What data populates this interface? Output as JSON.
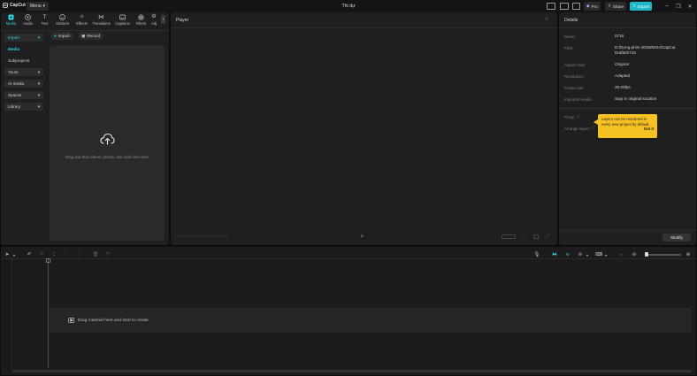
{
  "titlebar": {
    "app_name": "CapCut",
    "menu_label": "Menu",
    "project_title": "Thi dự",
    "pro_label": "Pro",
    "share_label": "Share",
    "export_label": "Export"
  },
  "tools": [
    {
      "label": "Media",
      "icon": "media-icon"
    },
    {
      "label": "Audio",
      "icon": "audio-icon"
    },
    {
      "label": "Text",
      "icon": "text-icon"
    },
    {
      "label": "Stickers",
      "icon": "stickers-icon"
    },
    {
      "label": "Effects",
      "icon": "effects-icon"
    },
    {
      "label": "Transitions",
      "icon": "transitions-icon"
    },
    {
      "label": "Captions",
      "icon": "captions-icon"
    },
    {
      "label": "Filters",
      "icon": "filters-icon"
    },
    {
      "label": "Adj",
      "icon": "adjustment-icon"
    }
  ],
  "sidebar": {
    "items": [
      {
        "label": "Import"
      },
      {
        "label": "Media"
      },
      {
        "label": "Subprojects"
      },
      {
        "label": "Yours"
      },
      {
        "label": "AI media"
      },
      {
        "label": "Spaces"
      },
      {
        "label": "Library"
      }
    ]
  },
  "media": {
    "import_label": "Import",
    "record_label": "Record",
    "drop_text": "Drag and drop videos, photos, and audio files here"
  },
  "player": {
    "title": "Player"
  },
  "details": {
    "title": "Details",
    "rows": [
      {
        "label": "Name:",
        "value": "0715"
      },
      {
        "label": "Path:",
        "value": "D:/Dựng phim 2025/MXH/CapCut Drafts/0715"
      },
      {
        "label": "Aspect ratio:",
        "value": "Original"
      },
      {
        "label": "Resolution:",
        "value": "Adapted"
      },
      {
        "label": "Frame rate:",
        "value": "25.00fps"
      },
      {
        "label": "Imported media:",
        "value": "Stay in original location"
      }
    ],
    "proxy_label": "Proxy",
    "arrange_label": "Arrange layers",
    "tooltip_text": "Layers can be reordered in every new project by default.",
    "tooltip_action": "Got it",
    "modify_label": "Modify"
  },
  "timeline": {
    "drag_text": "Drag material here and start to create"
  },
  "colors": {
    "accent": "#2ed3e6",
    "tooltip": "#f6c223",
    "export": "#1fb6c9"
  }
}
